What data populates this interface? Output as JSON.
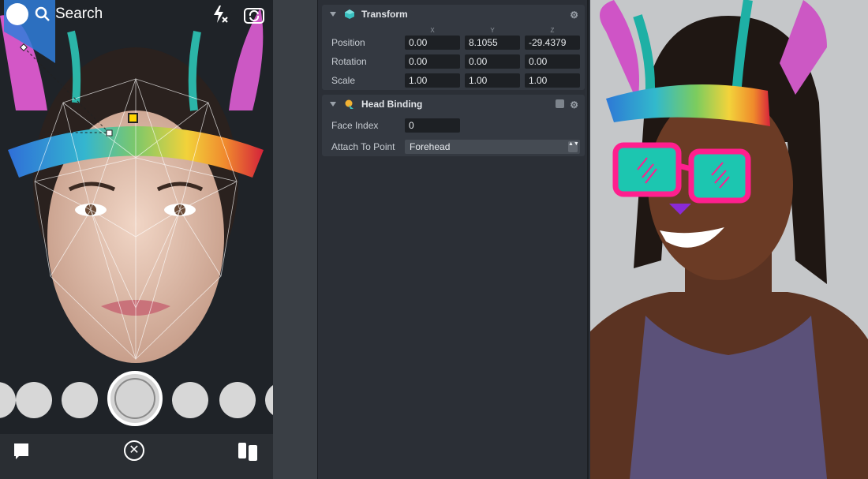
{
  "phone": {
    "search_label": "Search",
    "icons": {
      "search": "search-icon",
      "flash": "flash-off-icon",
      "flip": "flip-camera-icon",
      "chat": "chat-icon",
      "close": "close-icon",
      "stories": "stories-icon"
    },
    "close_glyph": "✕"
  },
  "inspector": {
    "transform": {
      "title": "Transform",
      "axis_labels": [
        "X",
        "Y",
        "Z"
      ],
      "rows": [
        {
          "label": "Position",
          "values": [
            "0.00",
            "8.1055",
            "-29.4379"
          ]
        },
        {
          "label": "Rotation",
          "values": [
            "0.00",
            "0.00",
            "0.00"
          ]
        },
        {
          "label": "Scale",
          "values": [
            "1.00",
            "1.00",
            "1.00"
          ]
        }
      ]
    },
    "head_binding": {
      "title": "Head Binding",
      "face_index_label": "Face Index",
      "face_index_value": "0",
      "attach_label": "Attach To Point",
      "attach_value": "Forehead"
    },
    "gear_glyph": "⚙",
    "arrows_glyph": "▲▼"
  },
  "colors": {
    "panel_bg": "#2b2f36",
    "card_bg": "#343941",
    "field_bg": "#1d2024",
    "accent_teal": "#39c0c0",
    "glasses_pink": "#ff1f8e"
  }
}
